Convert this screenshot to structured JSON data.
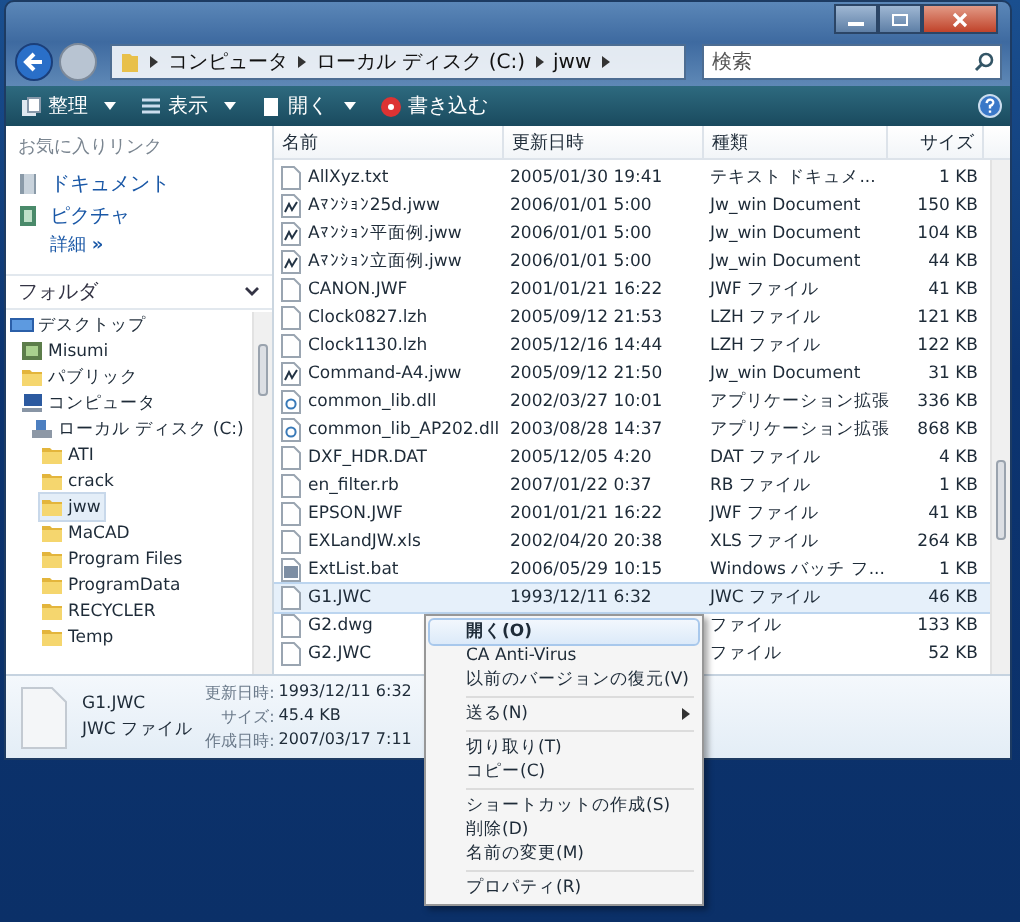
{
  "address": {
    "crumbs": [
      "コンピュータ",
      "ローカル ディスク (C:)",
      "jww"
    ]
  },
  "search": {
    "placeholder": "検索"
  },
  "toolbar": [
    {
      "kind": "organize",
      "label": "整理",
      "dropdown": true
    },
    {
      "kind": "views",
      "label": "表示",
      "dropdown": true
    },
    {
      "kind": "open",
      "label": "開く",
      "dropdown": true
    },
    {
      "kind": "burn",
      "label": "書き込む",
      "dropdown": false
    }
  ],
  "favorites": {
    "title": "お気に入りリンク",
    "items": [
      {
        "kind": "documents",
        "label": "ドキュメント"
      },
      {
        "kind": "pictures",
        "label": "ピクチャ"
      }
    ],
    "more": "詳細",
    "more_mark": "»"
  },
  "folders": {
    "title": "フォルダ",
    "tree": [
      {
        "kind": "desktop",
        "label": "デスクトップ",
        "selected": false,
        "children": [
          {
            "kind": "user",
            "label": "Misumi",
            "selected": false
          },
          {
            "kind": "folder",
            "label": "パブリック",
            "selected": false
          },
          {
            "kind": "computer",
            "label": "コンピュータ",
            "selected": false,
            "children": [
              {
                "kind": "drive",
                "label": "ローカル ディスク (C:)",
                "selected": false,
                "children": [
                  {
                    "kind": "folder",
                    "label": "ATI",
                    "selected": false
                  },
                  {
                    "kind": "folder",
                    "label": "crack",
                    "selected": false
                  },
                  {
                    "kind": "folder",
                    "label": "jww",
                    "selected": true
                  },
                  {
                    "kind": "folder",
                    "label": "MaCAD",
                    "selected": false
                  },
                  {
                    "kind": "folder",
                    "label": "Program Files",
                    "selected": false
                  },
                  {
                    "kind": "folder",
                    "label": "ProgramData",
                    "selected": false
                  },
                  {
                    "kind": "folder",
                    "label": "RECYCLER",
                    "selected": false
                  },
                  {
                    "kind": "folder",
                    "label": "Temp",
                    "selected": false
                  }
                ]
              }
            ]
          }
        ]
      }
    ]
  },
  "table": {
    "columns": [
      "名前",
      "更新日時",
      "種類",
      "サイズ"
    ],
    "rows": [
      {
        "kind": "blank",
        "name": "AllXyz.txt",
        "date": "2005/01/30 19:41",
        "type": "テキスト ドキュメ...",
        "size": "1 KB",
        "selected": false
      },
      {
        "kind": "drawing",
        "name": "Aﾏﾝｼｮﾝ25d.jww",
        "date": "2006/01/01 5:00",
        "type": "Jw_win Document",
        "size": "150 KB",
        "selected": false
      },
      {
        "kind": "drawing",
        "name": "Aﾏﾝｼｮﾝ平面例.jww",
        "date": "2006/01/01 5:00",
        "type": "Jw_win Document",
        "size": "104 KB",
        "selected": false
      },
      {
        "kind": "drawing",
        "name": "Aﾏﾝｼｮﾝ立面例.jww",
        "date": "2006/01/01 5:00",
        "type": "Jw_win Document",
        "size": "44 KB",
        "selected": false
      },
      {
        "kind": "blank",
        "name": "CANON.JWF",
        "date": "2001/01/21 16:22",
        "type": "JWF ファイル",
        "size": "41 KB",
        "selected": false
      },
      {
        "kind": "blank",
        "name": "Clock0827.lzh",
        "date": "2005/09/12 21:53",
        "type": "LZH ファイル",
        "size": "121 KB",
        "selected": false
      },
      {
        "kind": "blank",
        "name": "Clock1130.lzh",
        "date": "2005/12/16 14:44",
        "type": "LZH ファイル",
        "size": "122 KB",
        "selected": false
      },
      {
        "kind": "drawing",
        "name": "Command-A4.jww",
        "date": "2005/09/12 21:50",
        "type": "Jw_win Document",
        "size": "31 KB",
        "selected": false
      },
      {
        "kind": "library",
        "name": "common_lib.dll",
        "date": "2002/03/27 10:01",
        "type": "アプリケーション拡張",
        "size": "336 KB",
        "selected": false
      },
      {
        "kind": "library",
        "name": "common_lib_AP202.dll",
        "date": "2003/08/28 14:37",
        "type": "アプリケーション拡張",
        "size": "868 KB",
        "selected": false
      },
      {
        "kind": "blank",
        "name": "DXF_HDR.DAT",
        "date": "2005/12/05 4:20",
        "type": "DAT ファイル",
        "size": "4 KB",
        "selected": false
      },
      {
        "kind": "blank",
        "name": "en_filter.rb",
        "date": "2007/01/22 0:37",
        "type": "RB ファイル",
        "size": "1 KB",
        "selected": false
      },
      {
        "kind": "blank",
        "name": "EPSON.JWF",
        "date": "2001/01/21 16:22",
        "type": "JWF ファイル",
        "size": "41 KB",
        "selected": false
      },
      {
        "kind": "blank",
        "name": "EXLandJW.xls",
        "date": "2002/04/20 20:38",
        "type": "XLS ファイル",
        "size": "264 KB",
        "selected": false
      },
      {
        "kind": "batch",
        "name": "ExtList.bat",
        "date": "2006/05/29 10:15",
        "type": "Windows バッチ フ...",
        "size": "1 KB",
        "selected": false
      },
      {
        "kind": "blank",
        "name": "G1.JWC",
        "date": "1993/12/11 6:32",
        "type": "JWC ファイル",
        "size": "46 KB",
        "selected": true
      },
      {
        "kind": "blank",
        "name": "G2.dwg",
        "type": "ファイル",
        "size": "133 KB",
        "selected": false
      },
      {
        "kind": "blank",
        "name": "G2.JWC",
        "type": "ファイル",
        "size": "52 KB",
        "selected": false
      }
    ]
  },
  "details": {
    "name": "G1.JWC",
    "type": "JWC ファイル",
    "fields": [
      {
        "label": "更新日時:",
        "value": "1993/12/11 6:32"
      },
      {
        "label": "サイズ:",
        "value": "45.4 KB"
      },
      {
        "label": "作成日時:",
        "value": "2007/03/17 7:11"
      }
    ]
  },
  "context_menu": [
    {
      "kind": "item",
      "label": "開く(O)",
      "default": true,
      "submenu": false,
      "selected": true
    },
    {
      "kind": "item",
      "label": "CA Anti-Virus",
      "default": false,
      "submenu": false,
      "selected": false
    },
    {
      "kind": "item",
      "label": "以前のバージョンの復元(V)",
      "default": false,
      "submenu": false,
      "selected": false
    },
    {
      "kind": "separator"
    },
    {
      "kind": "item",
      "label": "送る(N)",
      "default": false,
      "submenu": true,
      "selected": false
    },
    {
      "kind": "separator"
    },
    {
      "kind": "item",
      "label": "切り取り(T)",
      "default": false,
      "submenu": false,
      "selected": false
    },
    {
      "kind": "item",
      "label": "コピー(C)",
      "default": false,
      "submenu": false,
      "selected": false
    },
    {
      "kind": "separator"
    },
    {
      "kind": "item",
      "label": "ショートカットの作成(S)",
      "default": false,
      "submenu": false,
      "selected": false
    },
    {
      "kind": "item",
      "label": "削除(D)",
      "default": false,
      "submenu": false,
      "selected": false
    },
    {
      "kind": "item",
      "label": "名前の変更(M)",
      "default": false,
      "submenu": false,
      "selected": false
    },
    {
      "kind": "separator"
    },
    {
      "kind": "item",
      "label": "プロパティ(R)",
      "default": false,
      "submenu": false,
      "selected": false
    }
  ]
}
